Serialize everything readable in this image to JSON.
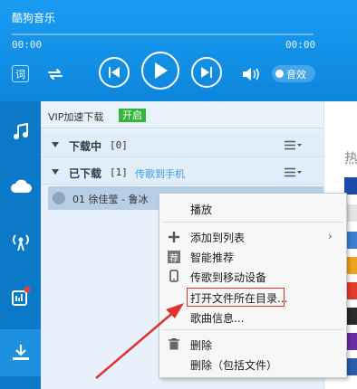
{
  "app": {
    "title": "酷狗音乐"
  },
  "player": {
    "time_current": "00:00",
    "time_total": "00:00",
    "lyric_label": "词",
    "sound_effect_label": "音效"
  },
  "list": {
    "vip_label": "VIP加速下载",
    "vip_badge": "开启",
    "downloading": {
      "title": "下载中",
      "count": "[0]"
    },
    "downloaded": {
      "title": "已下载",
      "count": "[1]",
      "link": "传歌到手机"
    },
    "song_row_text": "01  徐佳莹 - 鲁冰"
  },
  "right_panel": {
    "hot_label": "热"
  },
  "context_menu": {
    "items": [
      {
        "label": "播放"
      },
      {
        "label": "添加到列表",
        "has_submenu": true,
        "icon": "plus-icon"
      },
      {
        "label": "智能推荐",
        "icon": "recommend-icon",
        "icon_text": "荐"
      },
      {
        "label": "传歌到移动设备",
        "icon": "phone-icon"
      },
      {
        "label": "打开文件所在目录...",
        "highlighted": true
      },
      {
        "label": "歌曲信息..."
      },
      {
        "label": "删除",
        "icon": "trash-icon"
      },
      {
        "label": "删除（包括文件）"
      }
    ]
  },
  "colors": {
    "top_bar": "#1a9cf2",
    "nav": "#0b79c8",
    "vip_badge": "#35b53b",
    "link": "#3a9be8",
    "highlight": "#e0312e"
  }
}
